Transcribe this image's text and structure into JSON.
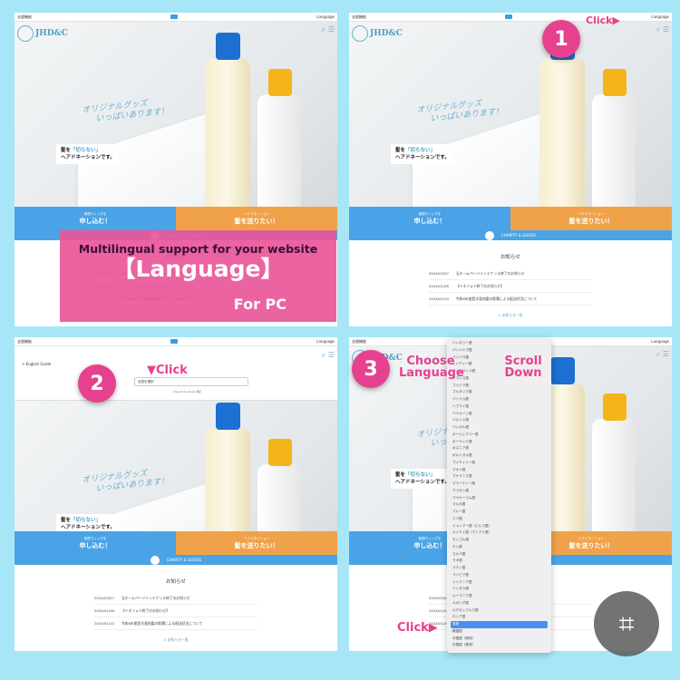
{
  "site": {
    "topbar_left": "支援機能",
    "topbar_right": "Language",
    "logo": "JHD&C",
    "slogan_line1": "オリジナルグッズ",
    "slogan_line2": "いっぱいあります！",
    "tag_prefix": "髪を",
    "tag_highlight": "「切らない」",
    "tag_line2": "ヘアドネーションです。",
    "cta_left_small": "無償ウィッグを",
    "cta_left": "申し込む！",
    "cta_right_small": "ヘアドネーション",
    "cta_right": "髪を送りたい！",
    "charity": "CHARITY & GOODS",
    "news_title": "お知らせ",
    "news": [
      {
        "date": "2024/02/07",
        "title": "当ホームページメンテナンス終了のお知らせ"
      },
      {
        "date": "2024/01/26",
        "title": "【ドネフォト終了のお知らせ】"
      },
      {
        "date": "2024/01/10",
        "title": "令和6年能登半島地震の影響による配送状況について"
      }
    ],
    "news_more": "> お知らせ一覧",
    "english_guide": "> English Guide",
    "select_placeholder": "言語を選択",
    "powered_by": "Powered by Google 翻訳"
  },
  "overlay": {
    "line1": "Multilingual support for your website",
    "line2": "【Language】",
    "line3": "For PC"
  },
  "steps": {
    "step1": "1",
    "step1_note": "Click▶",
    "step2": "2",
    "step2_note": "▼Click",
    "step3": "3",
    "step3_note": "Choose Language",
    "scroll_note": "Scroll Down",
    "click_note": "Click▶"
  },
  "languages": [
    "ハンガリー語",
    "パンジャブ語",
    "バンバラ語",
    "ヒンディー語",
    "フィンランド語",
    "フランス語",
    "フリジア語",
    "ブルガリア語",
    "ベトナム語",
    "ヘブライ語",
    "ベラルーシ語",
    "ペルシャ語",
    "ベンガル語",
    "ボージュプリー語",
    "ポーランド語",
    "ボスニア語",
    "ポルトガル語",
    "マイティリー語",
    "マオリ語",
    "マケドニア語",
    "マラーティー語",
    "マラガシ語",
    "マラヤーラム語",
    "マルタ語",
    "マレー語",
    "ミゾ語",
    "ミャンマー語（ビルマ語）",
    "メイテイ語（マニプリ語）",
    "モンゴル語",
    "モン語",
    "ヨルバ語",
    "ラオ語",
    "ラテン語",
    "ラトビア語",
    "リトアニア語",
    "リンガラ語",
    "ルーマニア語",
    "ルガンダ語",
    "ルクセンブルク語",
    "ロシア語",
    "英語",
    "韓国語",
    "中国語（簡体）",
    "中国語（繁体）"
  ],
  "selected_language": "英語",
  "colors": {
    "background": "#a6e6f7",
    "accent_pink": "#e6418e",
    "blue": "#4aa3e6",
    "orange": "#f0a24a"
  }
}
